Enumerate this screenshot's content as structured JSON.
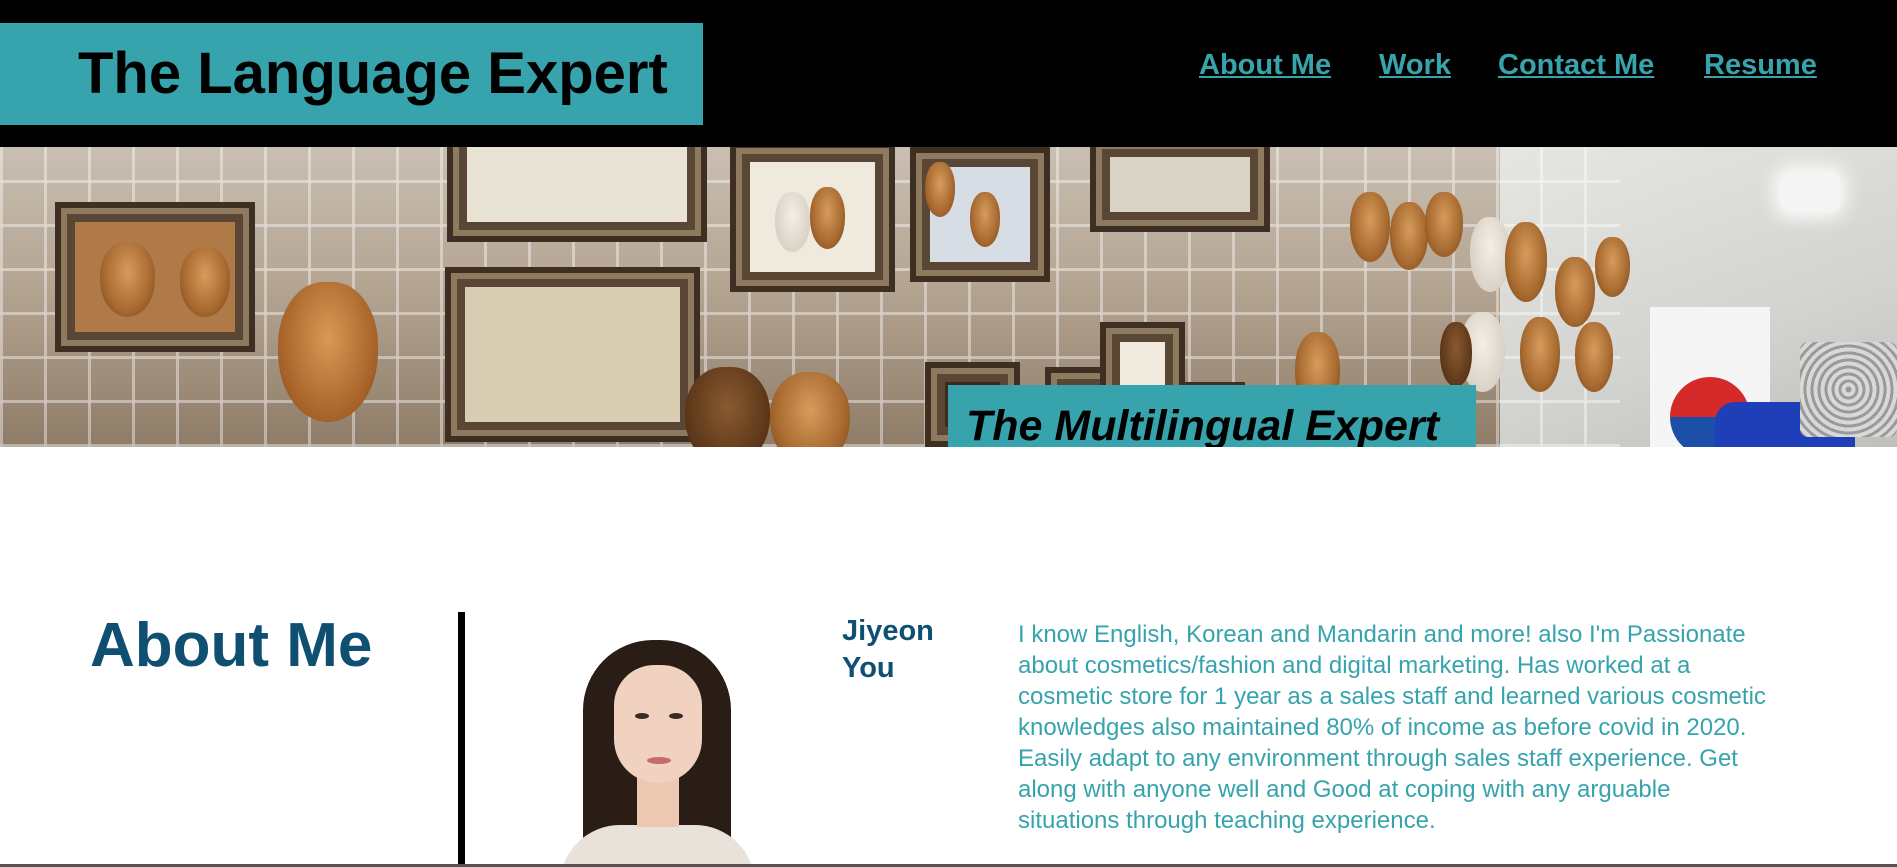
{
  "header": {
    "title": "The Language Expert",
    "nav": [
      {
        "label": "About Me"
      },
      {
        "label": "Work"
      },
      {
        "label": "Contact Me"
      },
      {
        "label": "Resume"
      }
    ]
  },
  "hero": {
    "tagline": "The Multilingual Expert"
  },
  "about": {
    "heading": "About Me",
    "name": "Jiyeon You",
    "bio": [
      "I know English, Korean and Mandarin and more! also I'm Passionate about cosmetics/fashion and digital marketing. Has worked at a cosmetic store for 1 year as a sales staff and learned various cosmetic knowledges also maintained 80% of income as before covid in 2020.",
      "Easily adapt to any environment through sales staff experience. Get along with anyone well and Good at coping with any arguable situations through teaching experience."
    ]
  },
  "colors": {
    "accent": "#36a3ad",
    "heading": "#0f4f72",
    "header_bg": "#000000"
  }
}
